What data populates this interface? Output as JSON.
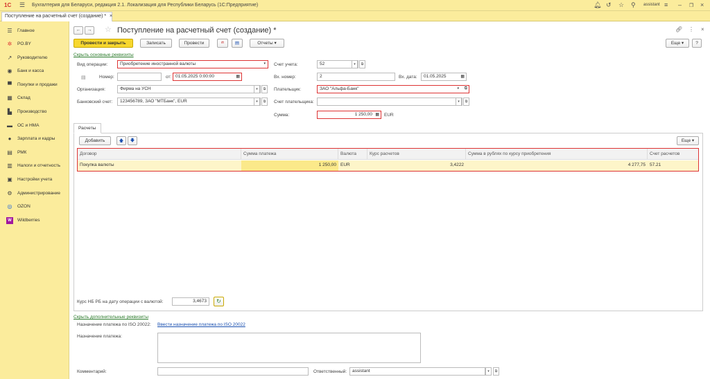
{
  "app": {
    "logo": "1С",
    "title": "Бухгалтерия для Беларуси, редакция 2.1. Локализация для Республики Беларусь   (1С:Предприятие)",
    "user": "assistant"
  },
  "tab": {
    "label": "Поступление на расчетный счет (создание) *",
    "close": "×"
  },
  "sidebar": {
    "items": [
      {
        "label": "Главное",
        "icon": "menu-icon"
      },
      {
        "label": "PO.BY",
        "icon": "star-icon"
      },
      {
        "label": "Руководителю",
        "icon": "chart-icon"
      },
      {
        "label": "Банк и касса",
        "icon": "bank-icon"
      },
      {
        "label": "Покупки и продажи",
        "icon": "cart-icon"
      },
      {
        "label": "Склад",
        "icon": "warehouse-icon"
      },
      {
        "label": "Производство",
        "icon": "factory-icon"
      },
      {
        "label": "ОС и НМА",
        "icon": "truck-icon"
      },
      {
        "label": "Зарплата и кадры",
        "icon": "person-icon"
      },
      {
        "label": "РМК",
        "icon": "register-icon"
      },
      {
        "label": "Налоги и отчетность",
        "icon": "taxes-icon"
      },
      {
        "label": "Настройки учета",
        "icon": "settings-doc-icon"
      },
      {
        "label": "Администрирование",
        "icon": "gear-icon"
      },
      {
        "label": "OZON",
        "icon": "ozon-icon"
      },
      {
        "label": "Wildberries",
        "icon": "wildberries-icon"
      }
    ]
  },
  "doc": {
    "title": "Поступление на расчетный счет (создание) *",
    "toolbar": {
      "post_close": "Провести и закрыть",
      "save": "Записать",
      "post": "Провести",
      "reports": "Отчеты",
      "more": "Еще"
    },
    "hide_main": "Скрыть основные реквизиты",
    "op_type_label": "Вид операции:",
    "op_type_value": "Приобретение иностранной валюты",
    "number_label": "Номер:",
    "number_value": "",
    "date_from_label": "от:",
    "date_value": "01.05.2025  0:00:00",
    "org_label": "Организация:",
    "org_value": "Фирма на УСН",
    "bank_account_label": "Банковский счет:",
    "bank_account_value": "123456789, ЗАО \"МТБанк\", EUR",
    "account_label": "Счет учета:",
    "account_value": "52",
    "in_number_label": "Вх. номер:",
    "in_number_value": "2",
    "in_date_label": "Вх. дата:",
    "in_date_value": "01.05.2025",
    "payer_label": "Плательщик:",
    "payer_value": "ЗАО \"Альфа-Банк\"",
    "payer_account_label": "Счет плательщика:",
    "payer_account_value": "",
    "sum_label": "Сумма:",
    "sum_value": "1 250,00",
    "currency": "EUR",
    "settlements_tab": "Расчеты",
    "add_button": "Добавить",
    "more_button": "Еще",
    "table": {
      "headers": [
        "Договор",
        "Сумма платежа",
        "Валюта",
        "Курс расчетов",
        "Сумма в рублях по курсу приобретения",
        "Счет расчетов"
      ],
      "rows": [
        [
          "Покупка валюты",
          "1 250,00",
          "EUR",
          "3,4222",
          "4 277,75",
          "57.21"
        ]
      ]
    },
    "nbrb_label": "Курс НБ РБ на дату операции с валютой:",
    "nbrb_value": "3,4673",
    "hide_extra": "Скрыть дополнительные реквизиты",
    "iso_label": "Назначение платежа по ISO 20022:",
    "iso_link": "Ввести назначение платежа по ISO 20022",
    "purpose_label": "Назначение платежа:",
    "purpose_value": "",
    "comment_label": "Комментарий:",
    "comment_value": "",
    "responsible_label": "Ответственный:",
    "responsible_value": "assistant"
  }
}
